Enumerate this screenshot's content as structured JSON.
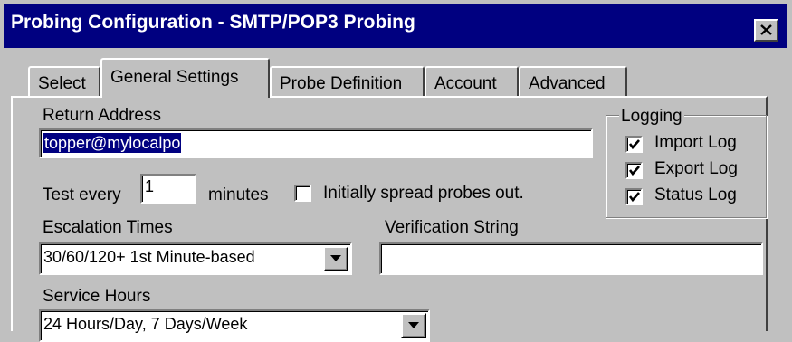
{
  "window": {
    "title": "Probing Configuration - SMTP/POP3 Probing"
  },
  "tabs": [
    {
      "label": "Select"
    },
    {
      "label": "General Settings"
    },
    {
      "label": "Probe Definition"
    },
    {
      "label": "Account"
    },
    {
      "label": "Advanced"
    }
  ],
  "active_tab": "General Settings",
  "general": {
    "return_address_label": "Return Address",
    "return_address_value": "topper@mylocalpo",
    "test_every_label": "Test every",
    "test_every_value": "1",
    "minutes_label": "minutes",
    "spread_probes_label": "Initially spread probes out.",
    "spread_probes_checked": false,
    "escalation_label": "Escalation Times",
    "escalation_value": "30/60/120+ 1st Minute-based",
    "verification_label": "Verification String",
    "verification_value": "",
    "service_hours_label": "Service Hours",
    "service_hours_value": "24 Hours/Day, 7 Days/Week"
  },
  "logging": {
    "title": "Logging",
    "items": [
      {
        "label": "Import Log",
        "checked": true
      },
      {
        "label": "Export Log",
        "checked": true
      },
      {
        "label": "Status Log",
        "checked": true
      }
    ]
  },
  "colors": {
    "titlebar": "#000080",
    "face": "#c0c0c0",
    "selection": "#000080"
  }
}
